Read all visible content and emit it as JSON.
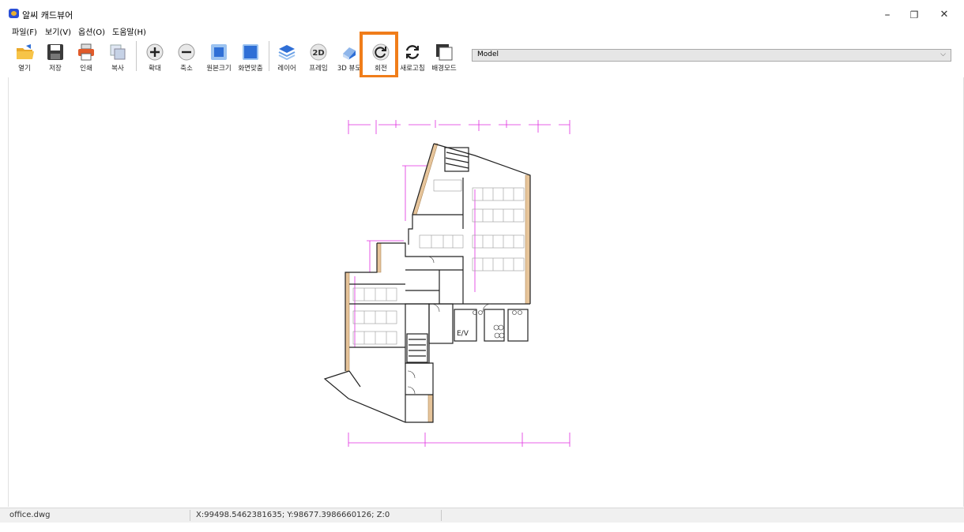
{
  "window": {
    "title": "알씨 캐드뷰어",
    "minimize": "–",
    "restore": "❐",
    "close": "✕"
  },
  "menu": [
    "파일(F)",
    "보기(V)",
    "옵션(O)",
    "도움말(H)"
  ],
  "toolbar": {
    "open": "열기",
    "save": "저장",
    "print": "인쇄",
    "copy": "복사",
    "zoom_in": "확대",
    "zoom_out": "축소",
    "original_size": "원본크기",
    "fit_screen": "화면맞춤",
    "layer": "레이어",
    "frame": "프레임",
    "view_3d": "3D 뷰모",
    "rotate": "회전",
    "refresh": "새로고침",
    "bg_mode": "배경모드"
  },
  "layout_select": {
    "value": "Model",
    "chevron": "⌵"
  },
  "drawing": {
    "elevator_label": "E/V"
  },
  "status": {
    "file": "office.dwg",
    "coords": "X:99498.5462381635; Y:98677.3986660126; Z:0"
  },
  "colors": {
    "dimension": "#e02de0",
    "wall": "#222222",
    "wall_fill": "#e6c49a",
    "highlight": "#f07d1a",
    "icon_blue": "#2f6fd6"
  }
}
